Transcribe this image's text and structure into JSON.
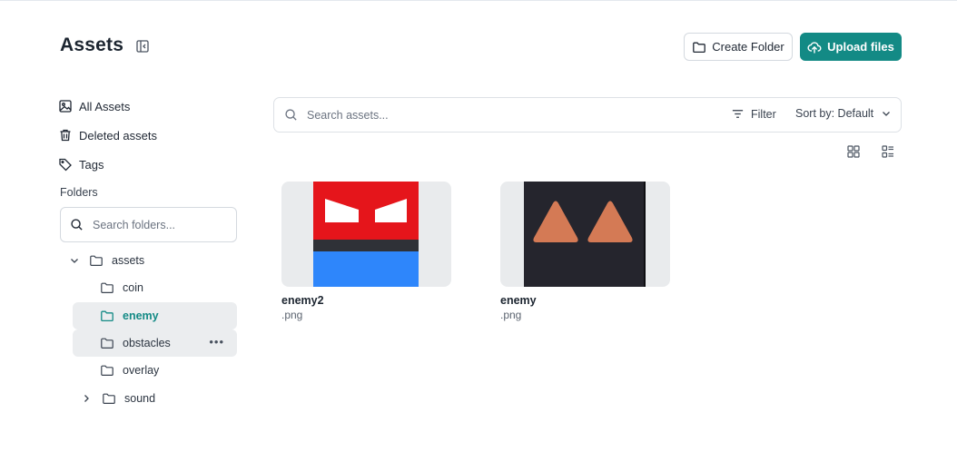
{
  "header": {
    "title": "Assets",
    "create_folder_label": "Create Folder",
    "upload_label": "Upload files"
  },
  "sidebar": {
    "nav": [
      {
        "label": "All Assets",
        "icon": "image-icon"
      },
      {
        "label": "Deleted assets",
        "icon": "trash-icon"
      },
      {
        "label": "Tags",
        "icon": "tag-icon"
      }
    ],
    "folders_heading": "Folders",
    "folder_search_placeholder": "Search folders...",
    "tree": [
      {
        "label": "assets",
        "expanded": true
      },
      {
        "label": "coin"
      },
      {
        "label": "enemy",
        "selected": true
      },
      {
        "label": "obstacles",
        "hovered": true,
        "more": "•••"
      },
      {
        "label": "overlay"
      },
      {
        "label": "sound",
        "expanded": false
      }
    ]
  },
  "main": {
    "search_placeholder": "Search assets...",
    "filter_label": "Filter",
    "sort_label": "Sort by: Default",
    "views": [
      "grid-view-icon",
      "list-view-icon"
    ],
    "assets": [
      {
        "name": "enemy2",
        "ext": ".png"
      },
      {
        "name": "enemy",
        "ext": ".png"
      }
    ]
  },
  "colors": {
    "accent": "#138a85",
    "selected_bg": "#ebedef",
    "thumb_bg": "#e9ebed",
    "enemy2_red": "#e5151b",
    "enemy2_blue": "#2e86fb",
    "enemy_dark": "#25252d",
    "enemy_triangle": "#d47a55"
  }
}
